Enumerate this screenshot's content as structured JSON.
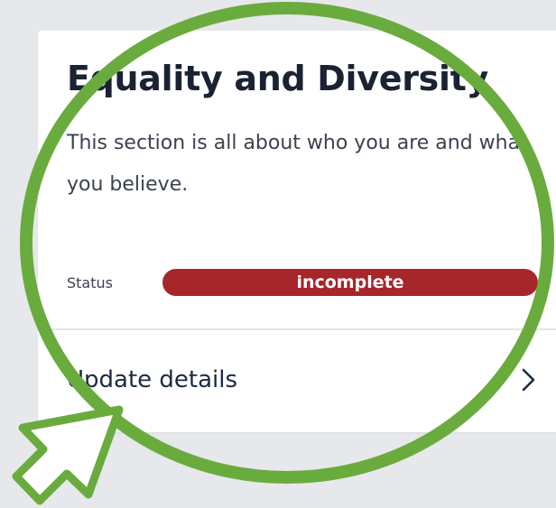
{
  "card": {
    "title": "Equality and Diversity",
    "description": "This section is all about who you are and what you believe.",
    "status_label": "Status",
    "status_value": "incomplete",
    "action_label": "Update details"
  },
  "icons": {
    "action_chevron": "chevron-right-icon",
    "highlight": "highlight-circle",
    "pointer": "pointer-arrow-icon"
  },
  "colors": {
    "background": "#e6e8ec",
    "card": "#ffffff",
    "status_incomplete": "#a6262a",
    "highlight": "#6aab3e"
  }
}
